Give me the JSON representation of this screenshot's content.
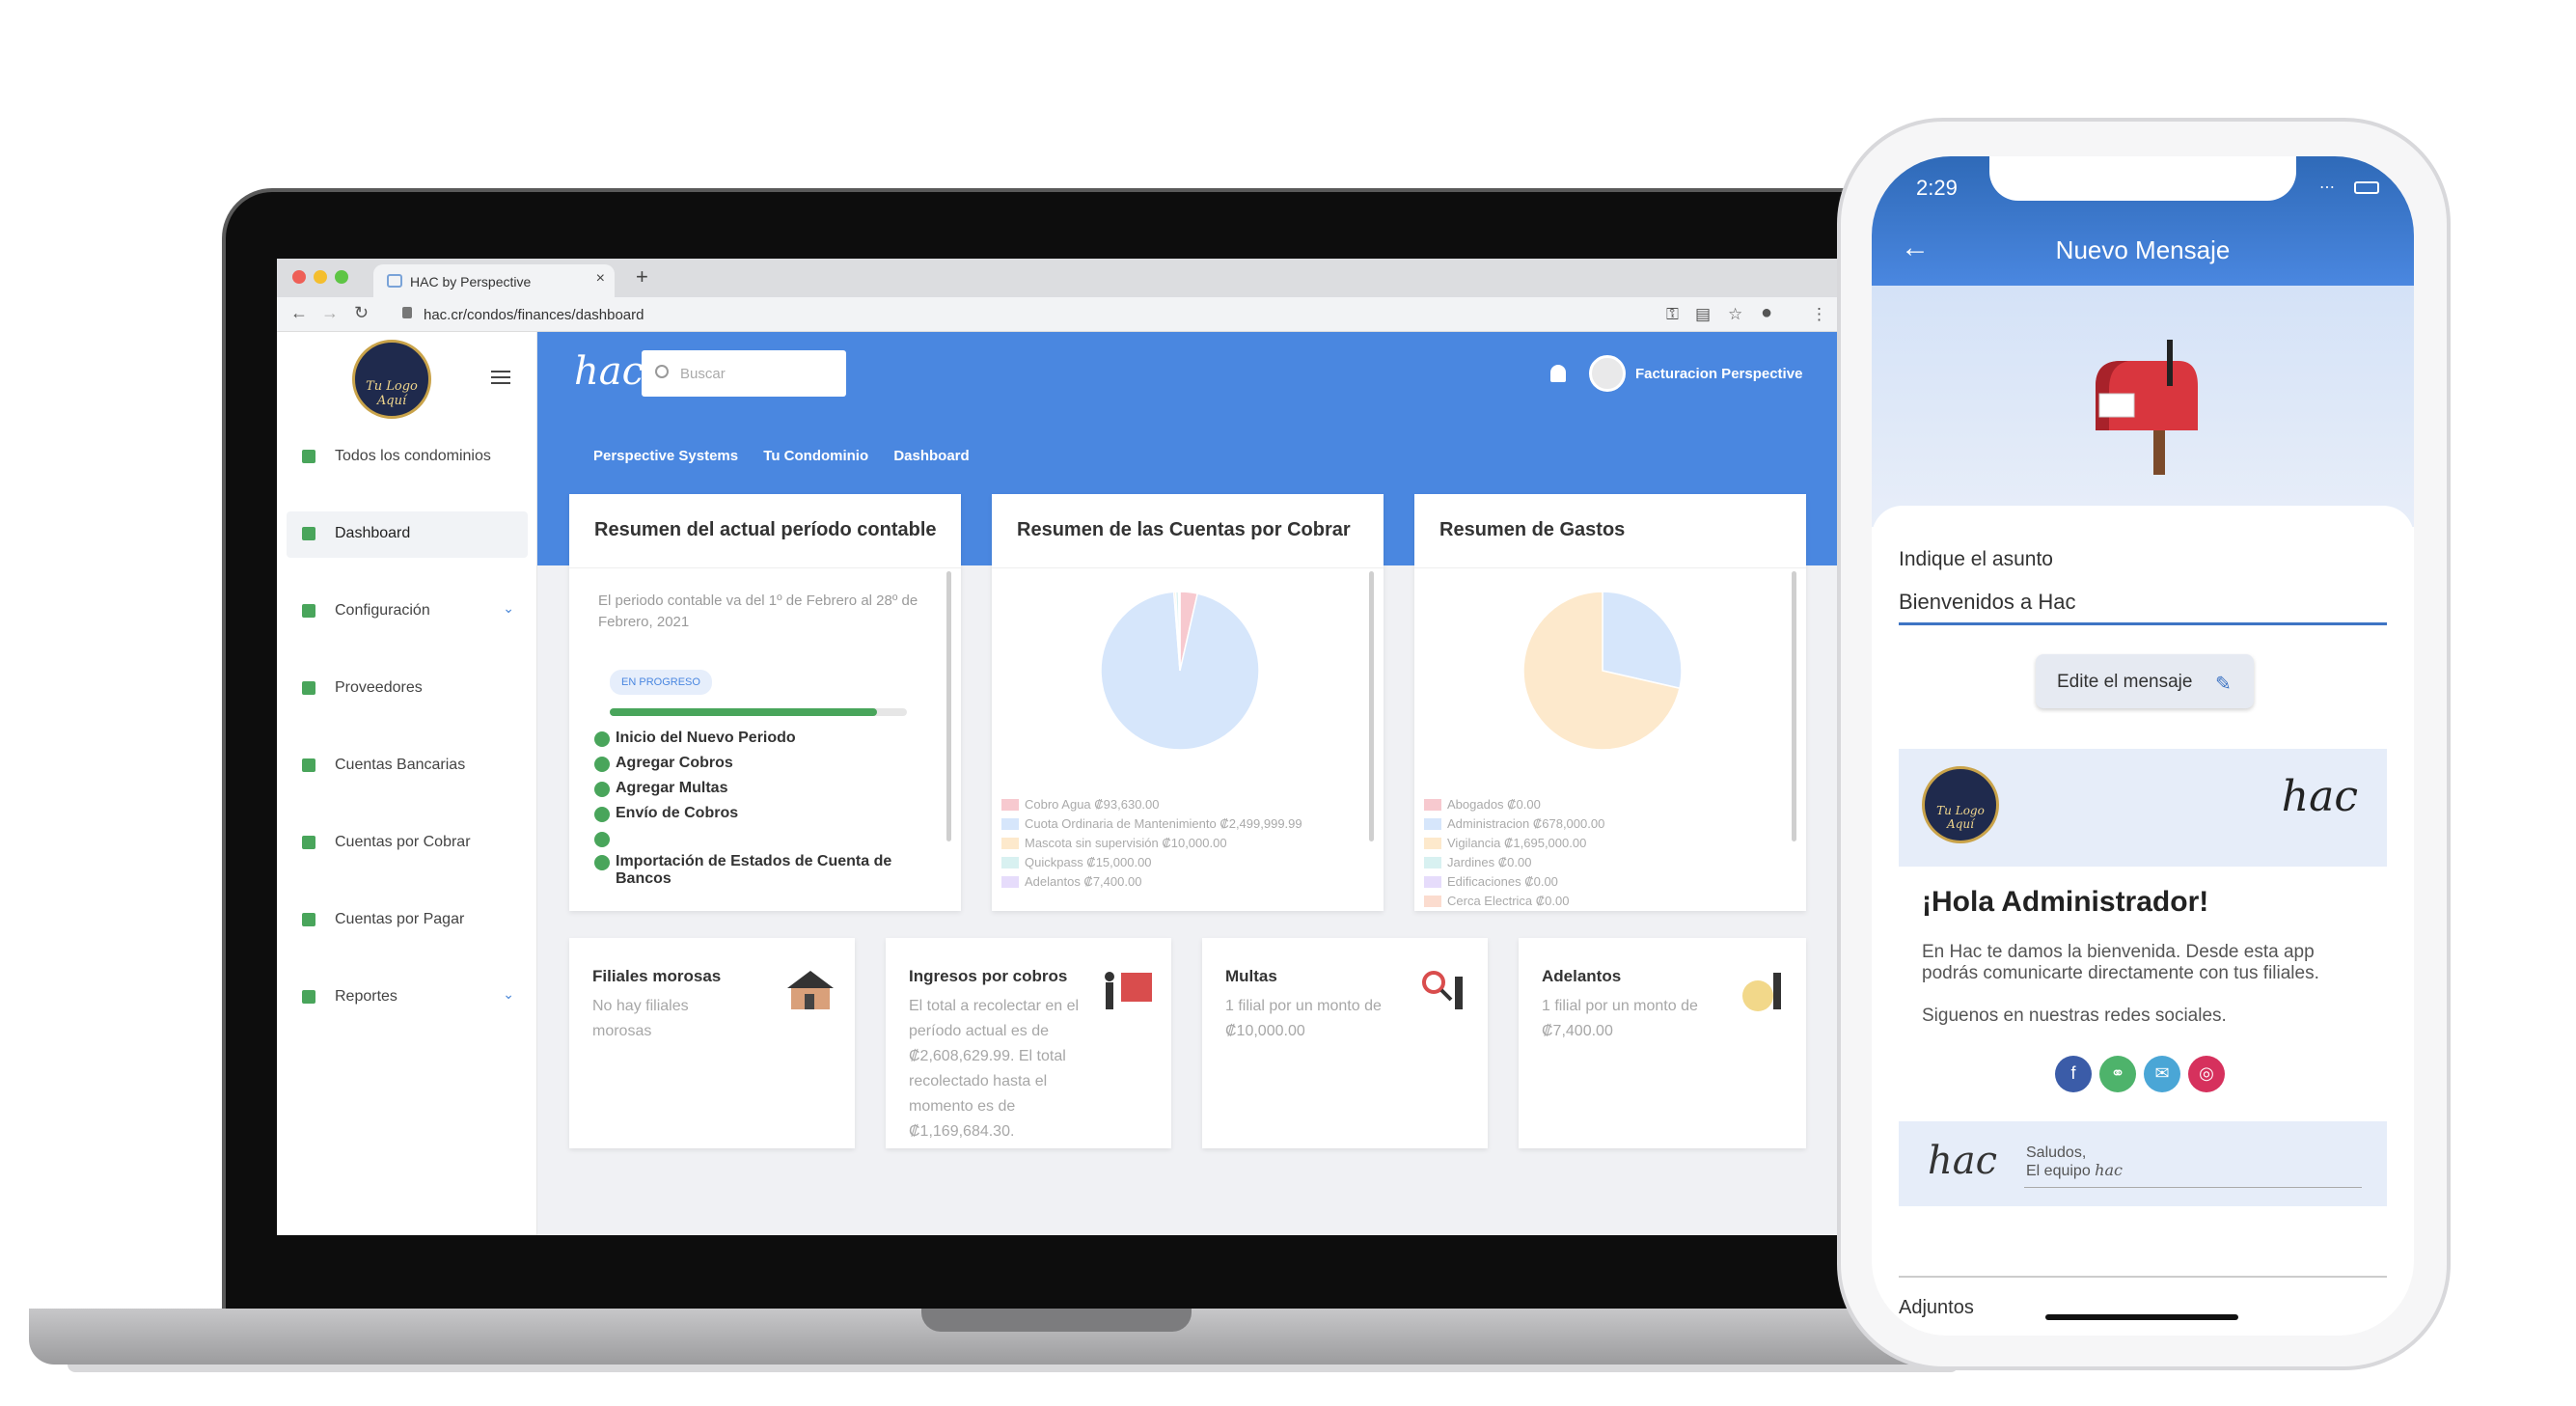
{
  "browser": {
    "tab_title": "HAC by Perspective",
    "tab_close": "×",
    "new_tab": "+",
    "url": "hac.cr/condos/finances/dashboard"
  },
  "app": {
    "logo_text": "Tu Logo Aquí",
    "brand": "hac",
    "search_placeholder": "Buscar",
    "user_name": "Facturacion Perspective",
    "breadcrumb": [
      "Perspective Systems",
      "Tu Condominio",
      "Dashboard"
    ]
  },
  "sidebar": {
    "items": [
      {
        "label": "Todos los condominios",
        "active": false,
        "chevron": false
      },
      {
        "label": "Dashboard",
        "active": true,
        "chevron": false
      },
      {
        "label": "Configuración",
        "active": false,
        "chevron": true
      },
      {
        "label": "Proveedores",
        "active": false,
        "chevron": false
      },
      {
        "label": "Cuentas Bancarias",
        "active": false,
        "chevron": false
      },
      {
        "label": "Cuentas por Cobrar",
        "active": false,
        "chevron": false
      },
      {
        "label": "Cuentas por Pagar",
        "active": false,
        "chevron": false
      },
      {
        "label": "Reportes",
        "active": false,
        "chevron": true
      }
    ]
  },
  "period_card": {
    "title": "Resumen del actual período contable",
    "description": "El periodo contable va del 1º de Febrero al 28º de Febrero, 2021",
    "badge": "EN PROGRESO",
    "progress": 0.9,
    "steps": [
      "Inicio del Nuevo Periodo",
      "Agregar Cobros",
      "Agregar Multas",
      "Envío de Cobros",
      "",
      "Importación de Estados de Cuenta de Bancos"
    ]
  },
  "cobrar_card": {
    "title": "Resumen de las Cuentas por Cobrar",
    "legend": [
      {
        "label": "Cobro Agua ₡93,630.00",
        "color": "#f7c9cf"
      },
      {
        "label": "Cuota Ordinaria de Mantenimiento ₡2,499,999.99",
        "color": "#d6e6fb"
      },
      {
        "label": "Mascota sin supervisión ₡10,000.00",
        "color": "#fde9cc"
      },
      {
        "label": "Quickpass ₡15,000.00",
        "color": "#d8f1f1"
      },
      {
        "label": "Adelantos ₡7,400.00",
        "color": "#e6dcfb"
      }
    ]
  },
  "gastos_card": {
    "title": "Resumen de Gastos",
    "legend": [
      {
        "label": "Abogados ₡0.00",
        "color": "#f7c9cf"
      },
      {
        "label": "Administracion ₡678,000.00",
        "color": "#d6e6fb"
      },
      {
        "label": "Vigilancia ₡1,695,000.00",
        "color": "#fde9cc"
      },
      {
        "label": "Jardines ₡0.00",
        "color": "#d8f1f1"
      },
      {
        "label": "Edificaciones ₡0.00",
        "color": "#e6dcfb"
      },
      {
        "label": "Cerca Electrica ₡0.00",
        "color": "#fbdccf"
      }
    ]
  },
  "chart_data": [
    {
      "type": "pie",
      "title": "Resumen de las Cuentas por Cobrar",
      "categories": [
        "Cobro Agua",
        "Cuota Ordinaria de Mantenimiento",
        "Mascota sin supervisión",
        "Quickpass",
        "Adelantos"
      ],
      "values": [
        93630.0,
        2499999.99,
        10000.0,
        15000.0,
        7400.0
      ],
      "colors": [
        "#f7c9cf",
        "#d6e6fb",
        "#fde9cc",
        "#d8f1f1",
        "#e6dcfb"
      ]
    },
    {
      "type": "pie",
      "title": "Resumen de Gastos",
      "categories": [
        "Abogados",
        "Administracion",
        "Vigilancia",
        "Jardines",
        "Edificaciones",
        "Cerca Electrica"
      ],
      "values": [
        0,
        678000.0,
        1695000.0,
        0,
        0,
        0
      ],
      "colors": [
        "#f7c9cf",
        "#d6e6fb",
        "#fde9cc",
        "#d8f1f1",
        "#e6dcfb",
        "#fbdccf"
      ]
    }
  ],
  "small_cards": [
    {
      "title": "Filiales morosas",
      "text": "No hay filiales morosas",
      "icon": "house-icon"
    },
    {
      "title": "Ingresos por cobros",
      "text": "El total a recolectar en el período actual es de ₡2,608,629.99. El total recolectado hasta el momento es de ₡1,169,684.30.",
      "icon": "calendar-person-icon"
    },
    {
      "title": "Multas",
      "text": "1 filial por un monto de ₡10,000.00",
      "icon": "magnifier-person-icon"
    },
    {
      "title": "Adelantos",
      "text": "1 filial por un monto de ₡7,400.00",
      "icon": "money-bag-icon"
    }
  ],
  "phone": {
    "time": "2:29",
    "title": "Nuevo Mensaje",
    "asunto_label": "Indique el asunto",
    "asunto_value": "Bienvenidos a Hac",
    "edit_button": "Edite el mensaje",
    "message": {
      "logo_text": "Tu Logo Aquí",
      "brand": "hac",
      "greeting": "¡Hola Administrador!",
      "body": "En Hac te damos la bienvenida.  Desde esta app podrás comunicarte directamente con tus filiales.",
      "social_text": "Siguenos en nuestras redes sociales.",
      "signoff_1": "Saludos,",
      "signoff_2": "El equipo",
      "signoff_brand": "hac"
    },
    "attachments_label": "Adjuntos"
  },
  "colors": {
    "primary": "#4a87e0",
    "success": "#49a55b",
    "facebook": "#3b5ca8",
    "link": "#4eb36b",
    "mail": "#4aa6d6",
    "instagram": "#d6315d"
  }
}
